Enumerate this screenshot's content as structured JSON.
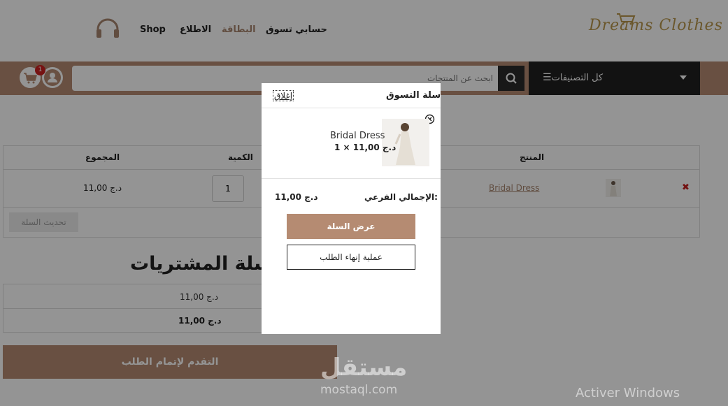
{
  "header": {
    "logo_text": "Dreams Clothes",
    "nav": {
      "account": "حسابي تسوق",
      "card": "البطاقة",
      "about": "الاطلاع",
      "shop": "Shop"
    }
  },
  "search_bar": {
    "categories_label": "كل التصنيفات",
    "search_placeholder": "ابحث عن المنتجات",
    "cart_count": "1"
  },
  "cart_table": {
    "headers": {
      "product": "المنتج",
      "quantity": "الكمية",
      "total": "المجموع"
    },
    "rows": [
      {
        "product_name": "Bridal Dress",
        "quantity": "1",
        "total": "11,00 د.ج"
      }
    ],
    "update_button": "تحديث السلة"
  },
  "cart_totals": {
    "title": "سلة المشتريات",
    "subtotal": "11,00 د.ج",
    "total": "11,00 د.ج",
    "checkout_button": "التقدم لإتمام الطلب"
  },
  "mini_cart": {
    "title": "سلة التسوق",
    "close_label": "إغلاق",
    "item_name": "Bridal Dress",
    "item_qty_price": "1 × 11,00 د.ج",
    "subtotal_label": "الإجمالي الفرعي:",
    "subtotal_value": "11,00 د.ج",
    "view_cart_button": "عرض السلة",
    "checkout_button": "عملية إنهاء الطلب"
  },
  "watermark": {
    "arabic": "مستقل",
    "latin": "mostaql.com"
  },
  "system_notice": "Activer Windows",
  "colors": {
    "accent": "#b58b72",
    "dark": "#1f1f1f",
    "link": "#a7866f",
    "remove": "#c62020"
  }
}
